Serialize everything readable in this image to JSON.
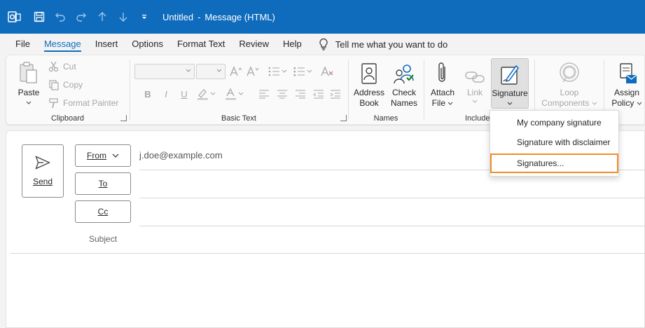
{
  "window": {
    "title": "Untitled",
    "separator": "-",
    "subtitle": "Message (HTML)",
    "accent": "#0f6cbd"
  },
  "menu": {
    "items": [
      "File",
      "Message",
      "Insert",
      "Options",
      "Format Text",
      "Review",
      "Help"
    ],
    "active": "Message",
    "tell_me": "Tell me what you want to do"
  },
  "ribbon": {
    "clipboard": {
      "label": "Clipboard",
      "paste": "Paste",
      "cut": "Cut",
      "copy": "Copy",
      "format_painter": "Format Painter"
    },
    "basic_text": {
      "label": "Basic Text"
    },
    "names": {
      "label": "Names",
      "address_book_1": "Address",
      "address_book_2": "Book",
      "check_names_1": "Check",
      "check_names_2": "Names"
    },
    "include": {
      "label": "Include",
      "attach_1": "Attach",
      "attach_2": "File",
      "link": "Link",
      "signature": "Signature"
    },
    "loop": {
      "label_1": "Loop",
      "label_2": "Components"
    },
    "assign": {
      "label_1": "Assign",
      "label_2": "Policy"
    }
  },
  "signature_menu": {
    "items": [
      "My company signature",
      "Signature with disclaimer",
      "Signatures..."
    ],
    "selected": "Signatures...",
    "highlight_color": "#f28c28"
  },
  "compose": {
    "send": "Send",
    "from": "From",
    "to": "To",
    "cc": "Cc",
    "from_address": "j.doe@example.com",
    "subject": "Subject"
  }
}
